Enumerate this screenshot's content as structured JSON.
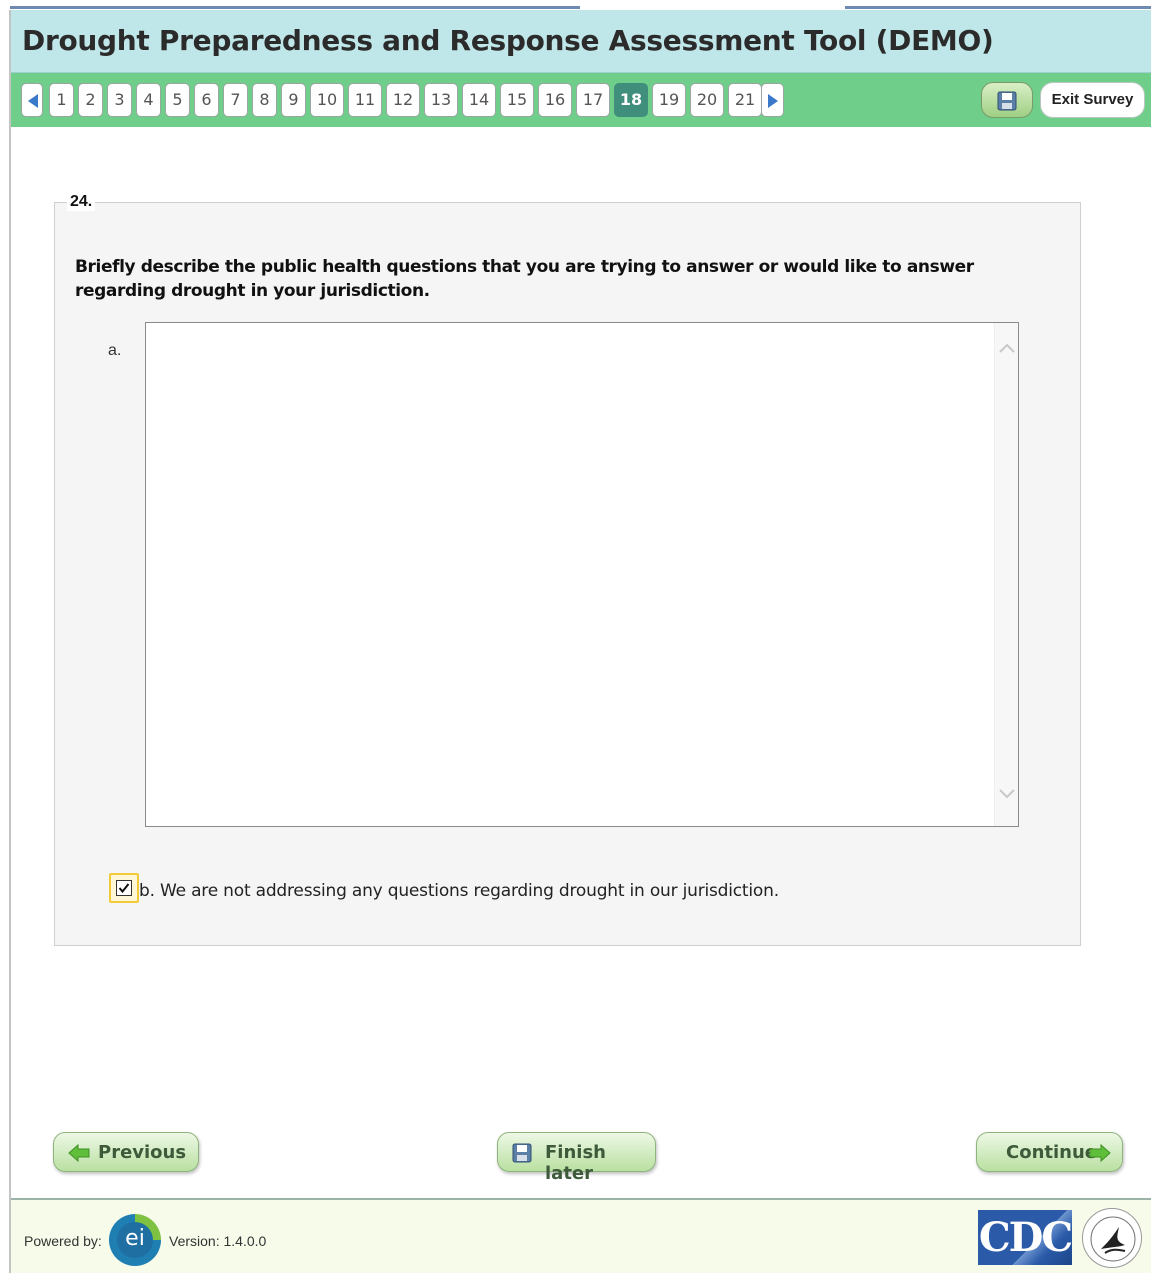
{
  "app": {
    "title": "Drought Preparedness and Response Assessment Tool (DEMO)"
  },
  "nav": {
    "pages": [
      "1",
      "2",
      "3",
      "4",
      "5",
      "6",
      "7",
      "8",
      "9",
      "10",
      "11",
      "12",
      "13",
      "14",
      "15",
      "16",
      "17",
      "18",
      "19",
      "20",
      "21"
    ],
    "current_page": "18",
    "exit_label": "Exit Survey"
  },
  "question": {
    "number": "24.",
    "text": "Briefly describe the public health questions that you are trying to answer or would like to answer regarding drought in your jurisdiction.",
    "option_a_label": "a.",
    "option_a_value": "",
    "option_b_label": "b. We are not addressing any questions regarding drought in our jurisdiction.",
    "option_b_checked": true
  },
  "buttons": {
    "previous": "Previous",
    "finish_later": "Finish later",
    "continue": "Continue"
  },
  "footer": {
    "powered_by": "Powered by:",
    "logo_text": "ei",
    "version": "Version: 1.4.0.0",
    "cdc_logo": "CDC"
  },
  "colors": {
    "header_bg": "#bfe6e8",
    "nav_bg": "#6fcf8a",
    "active_page": "#3f8f7c",
    "button_text": "#3d5a3a"
  },
  "icons": [
    "arrow-left-icon",
    "arrow-right-icon",
    "save-icon",
    "checkmark-icon",
    "green-arrow-left-icon",
    "green-arrow-right-icon",
    "chevron-up-icon",
    "chevron-down-icon"
  ]
}
